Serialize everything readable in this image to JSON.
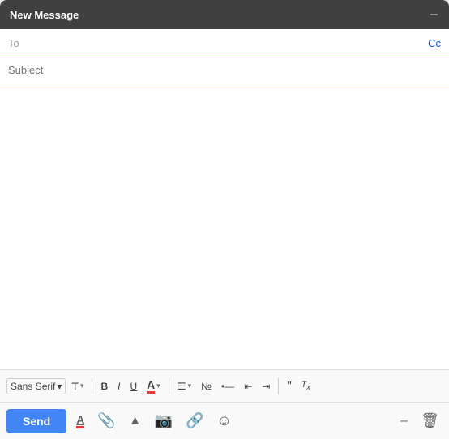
{
  "titleBar": {
    "title": "New Message",
    "minimizeLabel": "–"
  },
  "toRow": {
    "label": "To",
    "placeholder": "",
    "ccLabel": "Cc"
  },
  "subjectRow": {
    "placeholder": "Subject"
  },
  "body": {
    "placeholder": ""
  },
  "formattingToolbar": {
    "fontFamily": "Sans Serif",
    "fontArrow": "▾",
    "sizeArrow": "▾",
    "boldLabel": "B",
    "italicLabel": "I",
    "underlineLabel": "U",
    "colorLabel": "A",
    "alignArrow": "▾",
    "numberedListLabel": "≡",
    "bulletListLabel": "≡",
    "indentDecLabel": "←",
    "indentIncLabel": "→",
    "quoteLabel": "❝",
    "removeFormattingLabel": "Tx"
  },
  "bottomToolbar": {
    "sendLabel": "Send",
    "formattingIcon": "A",
    "attachIcon": "📎",
    "driveIcon": "▲",
    "photoIcon": "📷",
    "linkIcon": "🔗",
    "emojiIcon": "☺",
    "minimizeIcon": "–",
    "deleteIcon": "🗑"
  }
}
